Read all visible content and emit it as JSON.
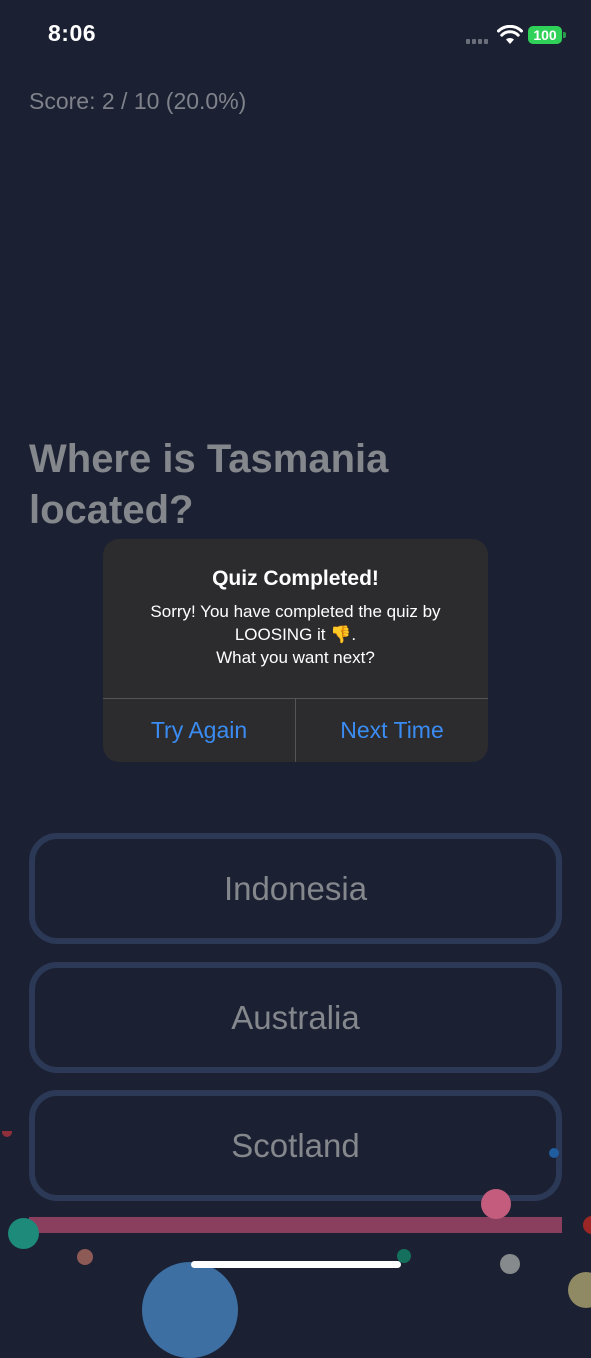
{
  "status_bar": {
    "time": "8:06",
    "battery": "100"
  },
  "quiz": {
    "score_text": "Score: 2 / 10 (20.0%)",
    "question": "Where is Tasmania located?",
    "answers": [
      {
        "label": "Indonesia"
      },
      {
        "label": "Australia"
      },
      {
        "label": "Scotland"
      }
    ]
  },
  "dialog": {
    "title": "Quiz Completed!",
    "message_line1": "Sorry! You have completed the quiz by",
    "message_line2": "LOOSING it 👎.",
    "message_line3": "What you want next?",
    "buttons": [
      {
        "label": "Try Again"
      },
      {
        "label": "Next Time"
      }
    ]
  },
  "colors": {
    "background": "#1b2032",
    "accent": "#3a8cf3",
    "answer_border": "#2b3856",
    "progress": "#8a3f5f",
    "battery": "#30d158"
  },
  "icons": [
    "signal-icon",
    "wifi-icon",
    "battery-icon",
    "thumbs-down-icon"
  ]
}
